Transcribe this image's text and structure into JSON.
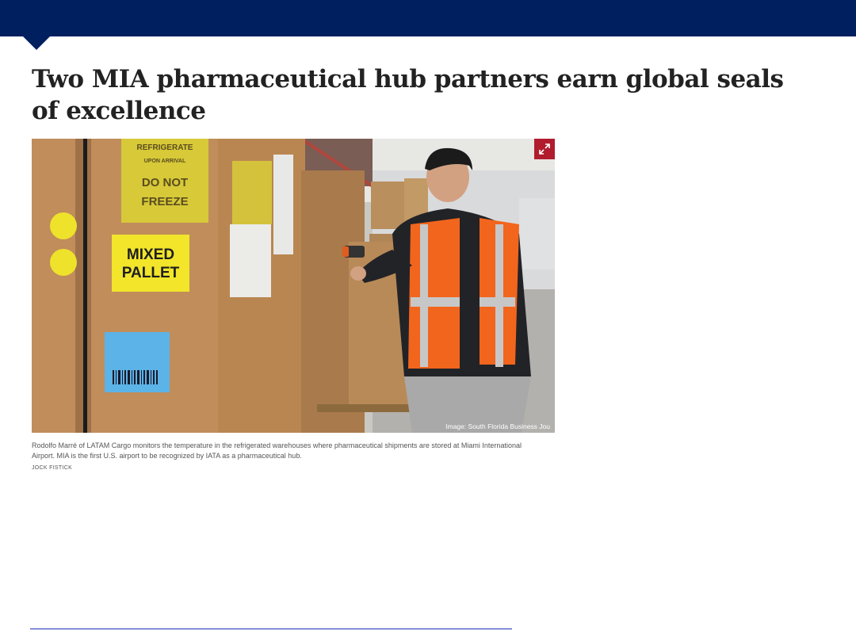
{
  "article": {
    "headline": "Two MIA pharmaceutical hub partners earn global seals of excellence",
    "photo": {
      "credit": "Image: South Florida Business Jou",
      "expand_icon": "expand-arrows-icon",
      "caption": "Rodolfo Marré of LATAM Cargo monitors the temperature in the refrigerated warehouses where pharmaceutical shipments are stored at Miami International Airport. MIA is the first U.S. airport to be recognized by IATA as a pharmaceutical hub.",
      "photographer": "JOCK FISTICK",
      "labels": {
        "refrigerate": "REFRIGERATE",
        "upon_arrival": "UPON ARRIVAL",
        "do_not": "DO NOT",
        "freeze": "FREEZE",
        "mixed": "MIXED",
        "pallet": "PALLET"
      }
    }
  },
  "colors": {
    "brand_navy": "#001f5f",
    "expand_red": "#b01c2e",
    "rule_blue": "#1c2fb5",
    "label_yellow": "#f2e52a",
    "vest_orange": "#f2651d"
  }
}
